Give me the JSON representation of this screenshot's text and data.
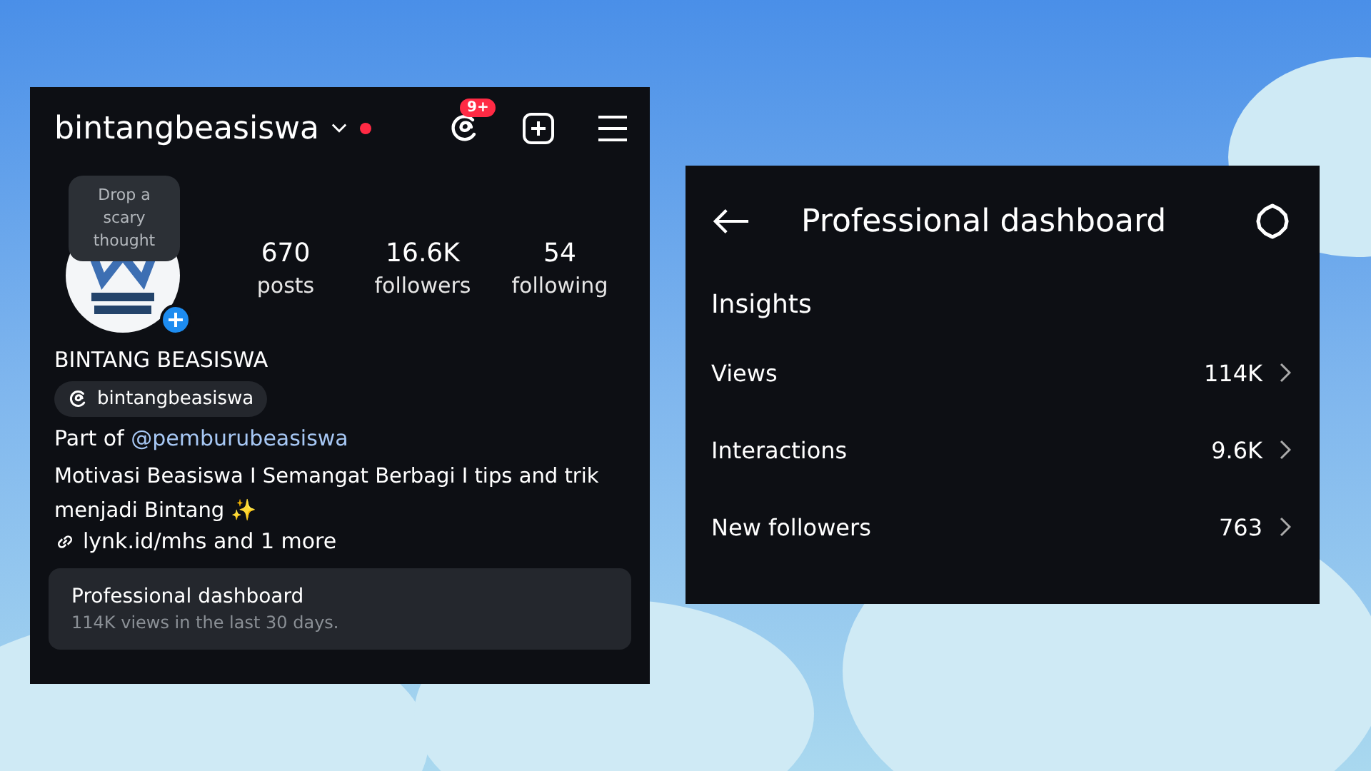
{
  "profile": {
    "username": "bintangbeasiswa",
    "live_dot": true,
    "threads_badge": "9+",
    "note": "Drop a scary thought",
    "stats": [
      {
        "value": "670",
        "label": "posts"
      },
      {
        "value": "16.6K",
        "label": "followers"
      },
      {
        "value": "54",
        "label": "following"
      }
    ],
    "name": "BINTANG BEASISWA",
    "threads_handle": "bintangbeasiswa",
    "part_of_prefix": "Part of",
    "part_of_link": "@pemburubeasiswa",
    "bio": "Motivasi Beasiswa I Semangat Berbagi I tips and trik menjadi Bintang ✨",
    "link": "lynk.id/mhs and 1 more",
    "dashboard_card": {
      "title": "Professional dashboard",
      "subtitle": "114K views in the last 30 days."
    }
  },
  "dashboard": {
    "title": "Professional dashboard",
    "section": "Insights",
    "rows": [
      {
        "label": "Views",
        "value": "114K"
      },
      {
        "label": "Interactions",
        "value": "9.6K"
      },
      {
        "label": "New followers",
        "value": "763"
      }
    ]
  }
}
